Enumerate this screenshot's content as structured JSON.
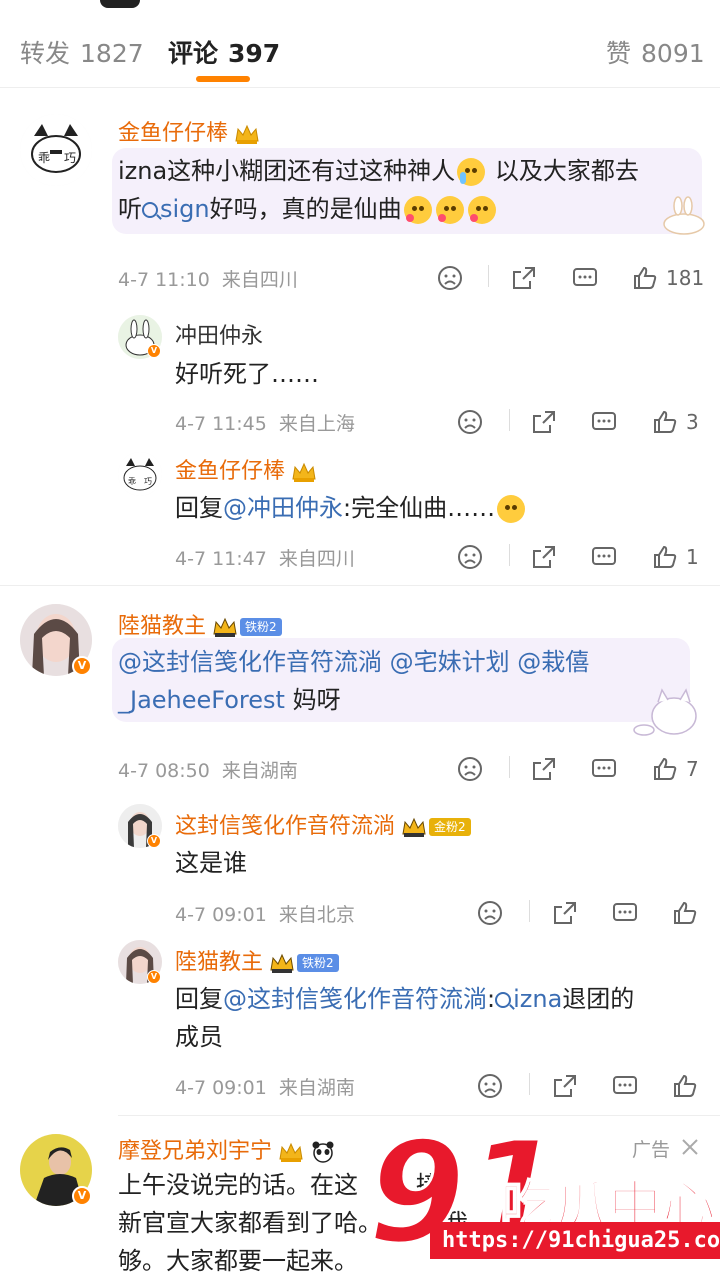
{
  "tabs": {
    "repost": {
      "label": "转发",
      "count": "1827"
    },
    "comment": {
      "label": "评论",
      "count": "397"
    },
    "like": {
      "label": "赞",
      "count": "8091"
    }
  },
  "colors": {
    "accent": "#ff8200",
    "name": "#e86b0a",
    "link": "#3a6db3",
    "watermark": "#e8192c"
  },
  "comments": [
    {
      "name": "金鱼仔仔棒",
      "text_a": "izna这种小糊团还有过这种神人",
      "text_b": " 以及大家都去",
      "text_c": "听",
      "topic": "sign",
      "text_d": "好吗，真的是仙曲",
      "time": "4-7 11:10",
      "location": "来自四川",
      "likes": "181",
      "replies": [
        {
          "name": "冲田仲永",
          "text": "好听死了……",
          "time": "4-7 11:45",
          "location": "来自上海",
          "likes": "3"
        },
        {
          "name": "金鱼仔仔棒",
          "prefix": "回复",
          "mention": "@冲田仲永",
          "text": ":完全仙曲……",
          "time": "4-7 11:47",
          "location": "来自四川",
          "likes": "1"
        }
      ]
    },
    {
      "name": "陸猫教主",
      "fan_badge": "铁粉2",
      "line1": "@这封信笺化作音符流淌 @宅妹计划 @栽僖",
      "line2_link": "_JaeheeForest",
      "line2_text": " 妈呀",
      "time": "4-7 08:50",
      "location": "来自湖南",
      "likes": "7",
      "replies": [
        {
          "name": "这封信笺化作音符流淌",
          "fan_badge": "金粉2",
          "text": "这是谁",
          "time": "4-7 09:01",
          "location": "来自北京"
        },
        {
          "name": "陸猫教主",
          "fan_badge": "铁粉2",
          "prefix": "回复",
          "mention": "@这封信笺化作音符流淌",
          "colon": ":",
          "topic": "izna",
          "text_a": "退团的",
          "text_b": "成员",
          "time": "4-7 09:01",
          "location": "来自湖南"
        }
      ]
    },
    {
      "name": "摩登兄弟刘宇宁",
      "ad_label": "广告",
      "line1": "上午没说完的话。在这",
      "line1b": "接",
      "line2": "新官宣大家都看到了哈。",
      "line2b": "我",
      "line2c": "代",
      "line3": "够。大家都要一起来。"
    }
  ],
  "watermark": {
    "big": "91",
    "brand": "吃瓜中心",
    "url": "https://91chigua25.com"
  }
}
